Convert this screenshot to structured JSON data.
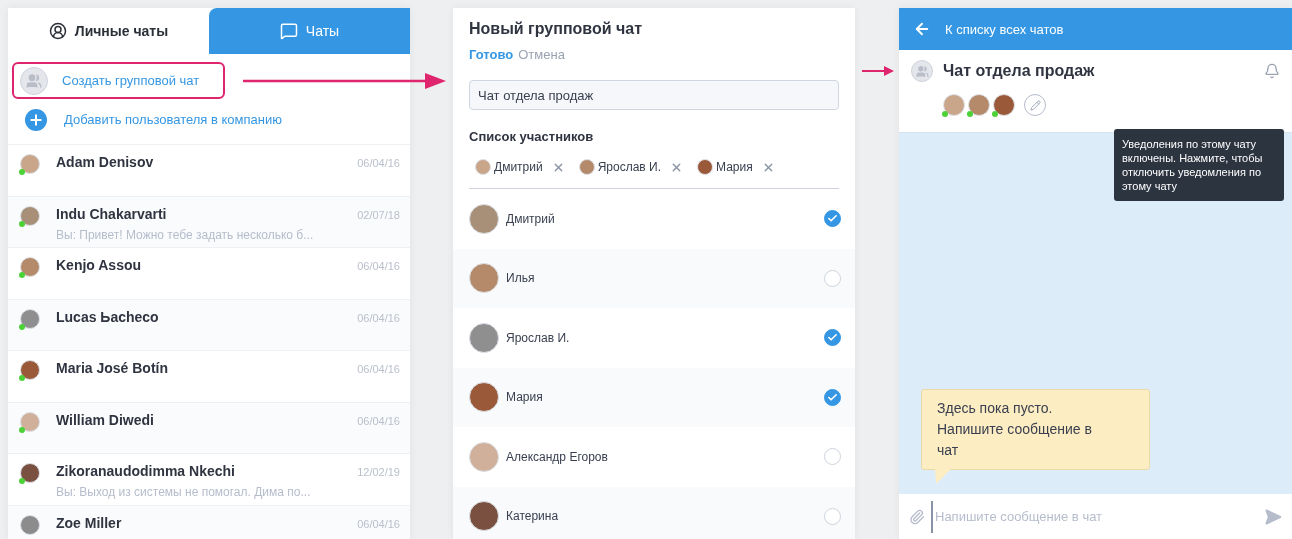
{
  "left_panel": {
    "tabs": [
      {
        "kind": "personal",
        "label": "Личные чаты",
        "selected": true
      },
      {
        "kind": "chats",
        "label": "Чаты",
        "selected": false
      }
    ],
    "actions": [
      {
        "kind": "group",
        "label": "Создать групповой чат",
        "highlighted": true
      },
      {
        "kind": "add",
        "label": "Добавить пользователя в компанию",
        "highlighted": false
      }
    ],
    "chats": [
      {
        "name": "Adam Denisov",
        "date": "06/04/16",
        "online": true
      },
      {
        "name": "Indu Chakarvarti",
        "date": "02/07/18",
        "preview": "Вы: Привет! Можно тебе задать несколько б...",
        "online": true
      },
      {
        "name": "Kenjo Assou",
        "date": "06/04/16",
        "online": true
      },
      {
        "name": "Lucas Ьacheco",
        "date": "06/04/16",
        "online": true
      },
      {
        "name": "Maria José Botín",
        "date": "06/04/16",
        "online": true
      },
      {
        "name": "William Diwedi",
        "date": "06/04/16",
        "online": true
      },
      {
        "name": "Zikoranaudodimma Nkechi",
        "date": "12/02/19",
        "preview": "Вы: Выход из системы не помогал. Дима по...",
        "online": true
      },
      {
        "name": "Zoe Miller",
        "date": "06/04/16",
        "online": false
      }
    ]
  },
  "new_group": {
    "title": "Новый групповой чат",
    "done": "Готово",
    "cancel": "Отмена",
    "name_value": "Чат отдела продаж",
    "members_heading": "Список участников",
    "chips": [
      {
        "name": "Дмитрий"
      },
      {
        "name": "Ярослав И."
      },
      {
        "name": "Мария"
      }
    ],
    "members": [
      {
        "name": "Дмитрий",
        "checked": true
      },
      {
        "name": "Илья",
        "checked": false
      },
      {
        "name": "Ярослав И.",
        "checked": true
      },
      {
        "name": "Мария",
        "checked": true
      },
      {
        "name": "Александр Егоров",
        "checked": false
      },
      {
        "name": "Катерина",
        "checked": false
      }
    ]
  },
  "chat": {
    "back": "К списку всех чатов",
    "title": "Чат отдела продаж",
    "participants": [
      {
        "online": true
      },
      {
        "online": true
      },
      {
        "online": true
      }
    ],
    "tooltip": "Уведоления по этому чату включены. Нажмите, чтобы отключить уведомления по этому чату",
    "empty_message": "Здесь пока пусто. Напишите сообщение в чат",
    "composer": {
      "placeholder": "Напишите сообщение в чат"
    }
  }
}
